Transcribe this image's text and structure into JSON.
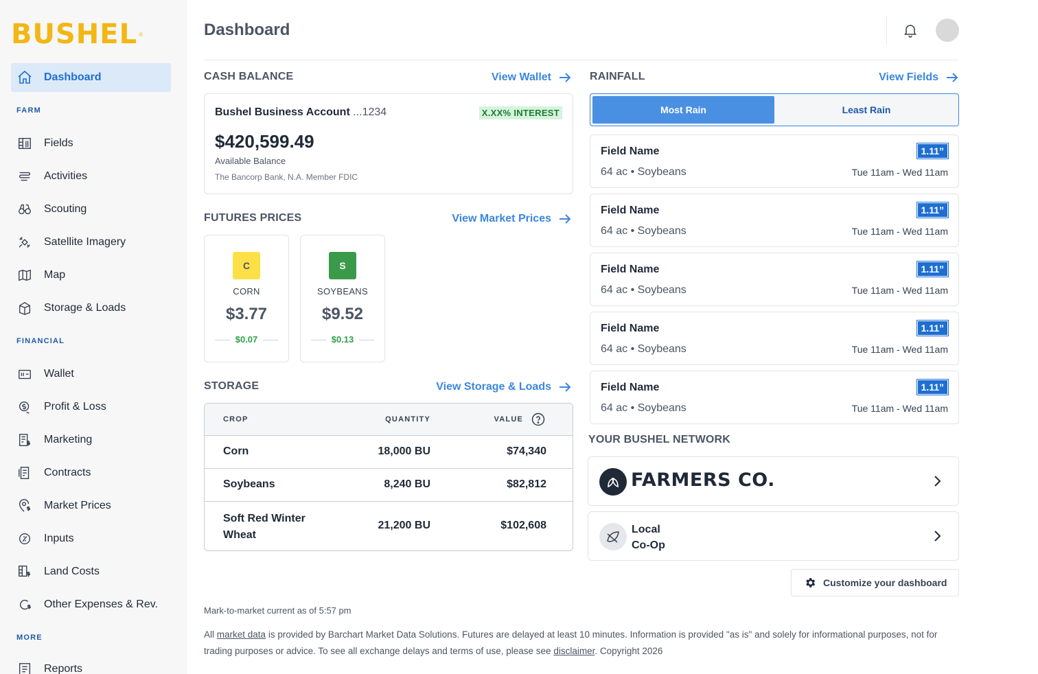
{
  "brand": {
    "name": "BUSHEL",
    "mark": "®",
    "color": "#f2b713"
  },
  "sidebar": {
    "items": [
      {
        "label": "Dashboard",
        "icon": "home-icon",
        "active": true
      },
      {
        "label": "Fields",
        "icon": "fields-icon"
      },
      {
        "label": "Activities",
        "icon": "activities-icon"
      },
      {
        "label": "Scouting",
        "icon": "binoculars-icon"
      },
      {
        "label": "Satellite Imagery",
        "icon": "satellite-icon"
      },
      {
        "label": "Map",
        "icon": "map-icon"
      },
      {
        "label": "Storage & Loads",
        "icon": "storage-bin-icon"
      },
      {
        "label": "Wallet",
        "icon": "wallet-icon"
      },
      {
        "label": "Profit & Loss",
        "icon": "profit-loss-icon"
      },
      {
        "label": "Marketing",
        "icon": "marketing-icon"
      },
      {
        "label": "Contracts",
        "icon": "contracts-icon"
      },
      {
        "label": "Market Prices",
        "icon": "market-prices-icon"
      },
      {
        "label": "Inputs",
        "icon": "inputs-icon"
      },
      {
        "label": "Land Costs",
        "icon": "land-costs-icon"
      },
      {
        "label": "Other Expenses & Rev.",
        "icon": "other-expenses-icon"
      },
      {
        "label": "Reports",
        "icon": "reports-icon"
      }
    ],
    "sections": {
      "farm": "FARM",
      "financial": "FINANCIAL",
      "more": "MORE"
    }
  },
  "header": {
    "title": "Dashboard"
  },
  "cash_balance": {
    "title": "CASH BALANCE",
    "link": "View Wallet",
    "account_name": "Bushel Business Account",
    "account_number": " ...1234",
    "interest": "X.XX% INTEREST",
    "balance": "$420,599.49",
    "balance_label": "Available Balance",
    "bank": "The Bancorp Bank, N.A. Member FDIC"
  },
  "futures": {
    "title": "FUTURES PRICES",
    "link": "View Market Prices",
    "items": [
      {
        "badge": "C",
        "name": "CORN",
        "price": "$3.77",
        "change": "$0.07",
        "badge_bg": "#fde047",
        "badge_color": "#4b5563"
      },
      {
        "badge": "S",
        "name": "SOYBEANS",
        "price": "$9.52",
        "change": "$0.13",
        "badge_bg": "#3a9a4a",
        "badge_color": "#ffffff"
      }
    ]
  },
  "storage": {
    "title": "STORAGE",
    "link": "View Storage & Loads",
    "headers": {
      "crop": "CROP",
      "quantity": "QUANTITY",
      "value": "VALUE"
    },
    "rows": [
      {
        "crop": "Corn",
        "quantity": "18,000 BU",
        "value": "$74,340"
      },
      {
        "crop": "Soybeans",
        "quantity": "8,240 BU",
        "value": "$82,812"
      },
      {
        "crop_line1": "Soft Red Winter",
        "crop_line2": "Wheat",
        "quantity": "21,200 BU",
        "value": "$102,608"
      }
    ]
  },
  "rainfall": {
    "title": "RAINFALL",
    "link": "View Fields",
    "toggle": {
      "on": "Most Rain",
      "off": "Least Rain"
    },
    "fields": [
      {
        "name": "Field Name",
        "sub": "64 ac • Soybeans",
        "amount": "1.11”",
        "time": "Tue 11am - Wed 11am"
      },
      {
        "name": "Field Name",
        "sub": "64 ac • Soybeans",
        "amount": "1.11”",
        "time": "Tue 11am - Wed 11am"
      },
      {
        "name": "Field Name",
        "sub": "64 ac • Soybeans",
        "amount": "1.11”",
        "time": "Tue 11am - Wed 11am"
      },
      {
        "name": "Field Name",
        "sub": "64 ac • Soybeans",
        "amount": "1.11”",
        "time": "Tue 11am - Wed 11am"
      },
      {
        "name": "Field Name",
        "sub": "64 ac • Soybeans",
        "amount": "1.11”",
        "time": "Tue 11am - Wed 11am"
      }
    ]
  },
  "network": {
    "title": "YOUR BUSHEL NETWORK",
    "farmers_co": "FARMERS CO.",
    "local_line1": "Local",
    "local_line2": "Co-Op"
  },
  "customize": "Customize your dashboard",
  "footer": {
    "mtm": "Mark-to-market current as of 5:57 pm",
    "d1": "All ",
    "market_data_link": "market data",
    "d2": " is provided by Barchart Market Data Solutions. Futures are delayed at least 10 minutes. Information is provided \"as is\" and solely for informational purposes, not for trading purposes or advice. To see all exchange delays and terms of use, please see ",
    "disclaimer_link": "disclaimer",
    "d3": ". Copyright 2026"
  }
}
